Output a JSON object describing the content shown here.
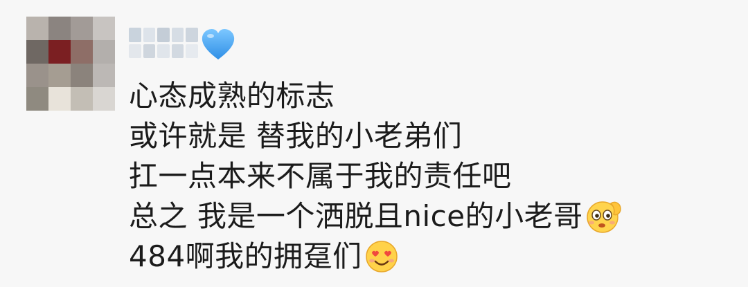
{
  "comment": {
    "author": {
      "avatar_icon": "pixelated-avatar",
      "name_icon": "pixelated-username",
      "badge_icon": "blue-heart-icon",
      "badge_color": "#4ea8f3"
    },
    "lines": [
      {
        "text": "心态成熟的标志"
      },
      {
        "text": "或许就是 替我的小老弟们"
      },
      {
        "text": "扛一点本来不属于我的责任吧"
      },
      {
        "text": "总之 我是一个洒脱且nice的小老哥",
        "emoji": "saluting-face-icon"
      },
      {
        "text": "484啊我的拥趸们",
        "emoji": "smiling-heart-eyes-face-icon"
      }
    ]
  },
  "colors": {
    "background": "#f7f7f7",
    "text": "#1b1b1b"
  }
}
